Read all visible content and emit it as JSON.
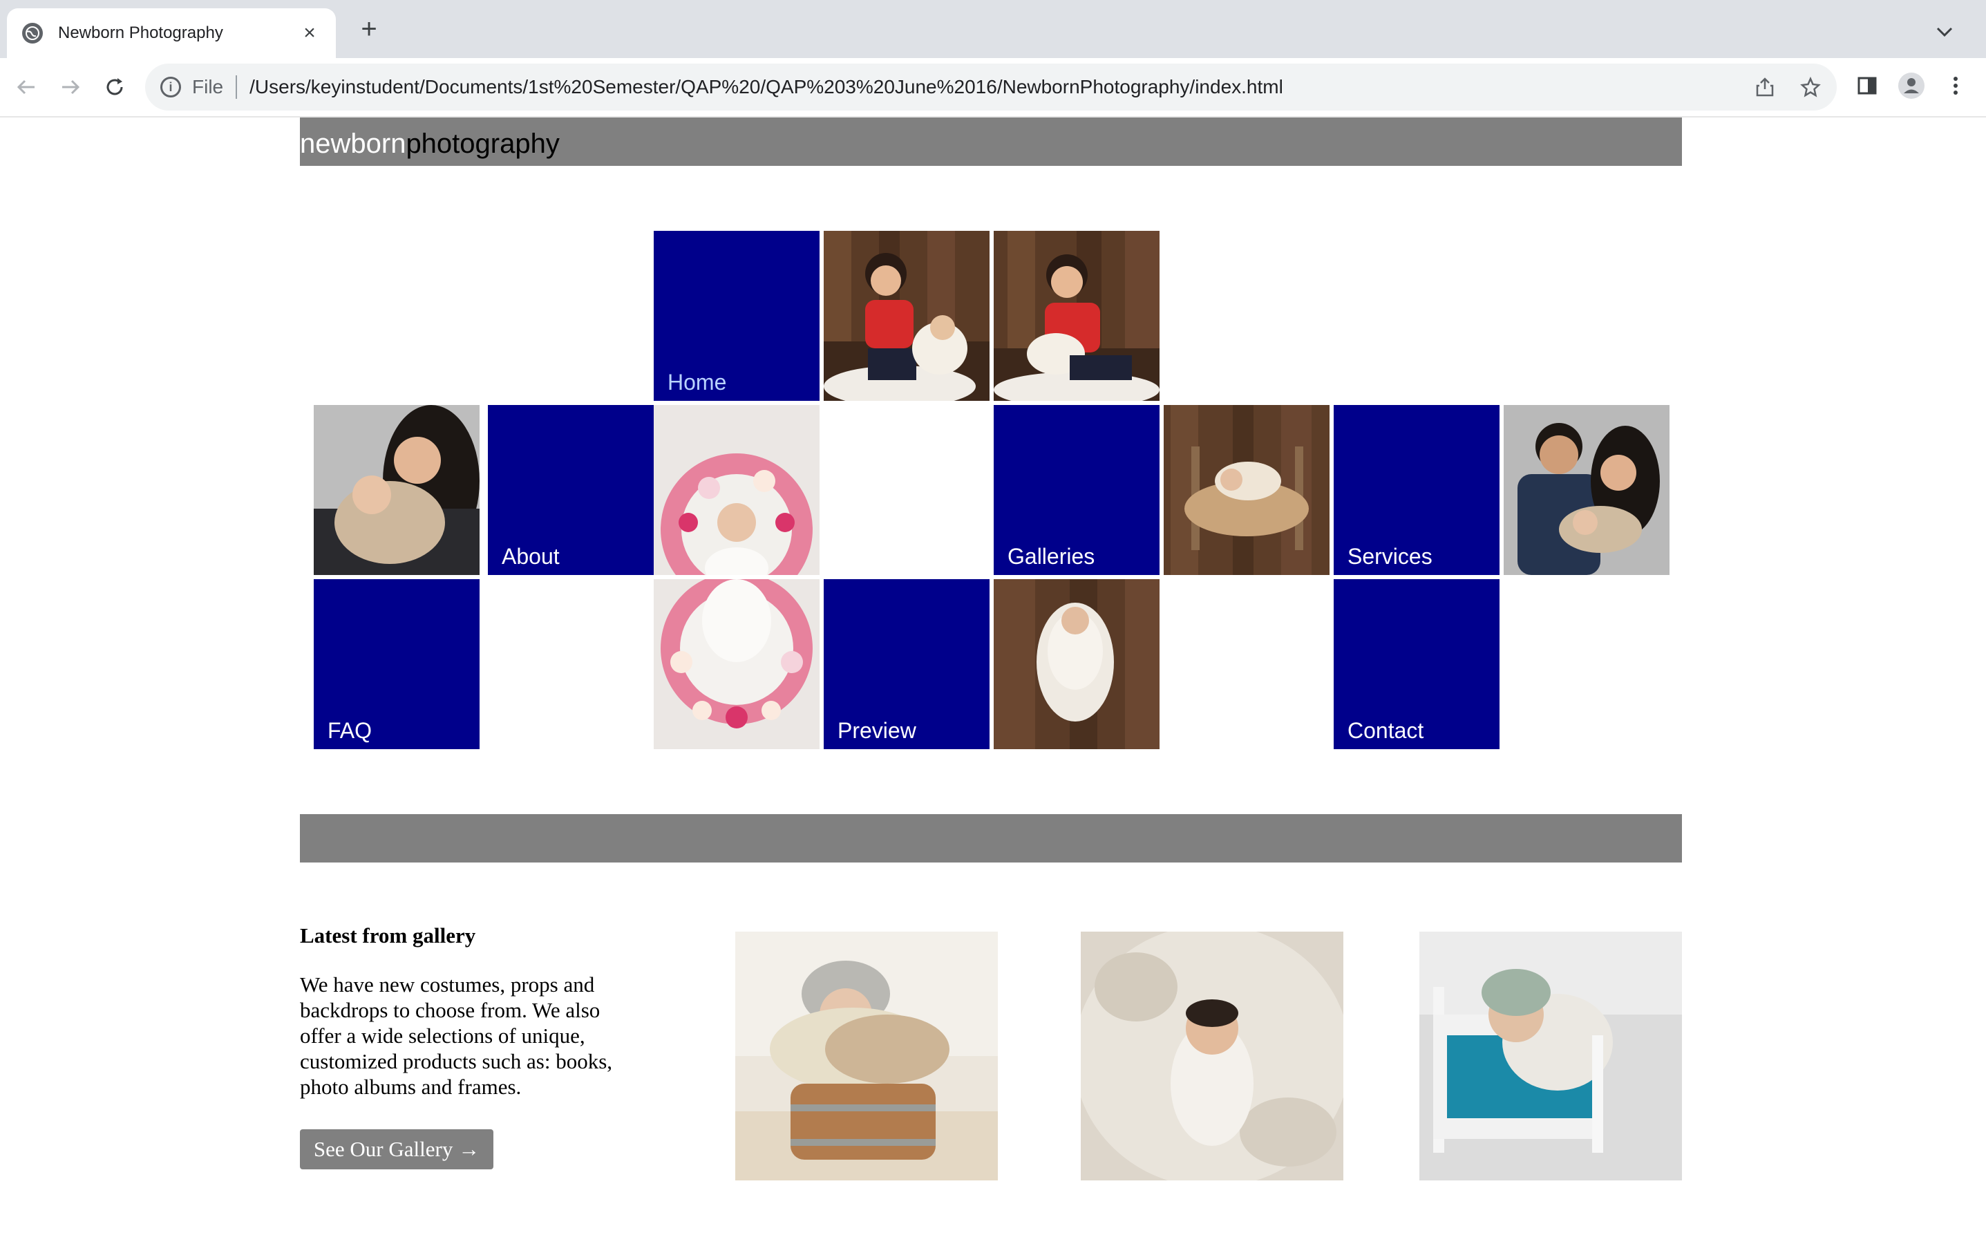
{
  "browser": {
    "tab_title": "Newborn Photography",
    "address_scheme": "File",
    "address_url": "/Users/keyinstudent/Documents/1st%20Semester/QAP%20/QAP%203%20June%2016/NewbornPhotography/index.html"
  },
  "site": {
    "logo_light": "newborn",
    "logo_dark": "photography"
  },
  "nav": {
    "home": "Home",
    "about": "About",
    "galleries": "Galleries",
    "services": "Services",
    "faq": "FAQ",
    "preview": "Preview",
    "contact": "Contact"
  },
  "latest": {
    "heading": "Latest from gallery",
    "body": "We have new costumes, props and backdrops to choose from. We also offer a wide selections of unique, customized products such as: books, photo albums and frames.",
    "button_label": "See Our Gallery →"
  },
  "colors": {
    "nav_tile": "#00008b",
    "bar_gray": "#808080"
  }
}
